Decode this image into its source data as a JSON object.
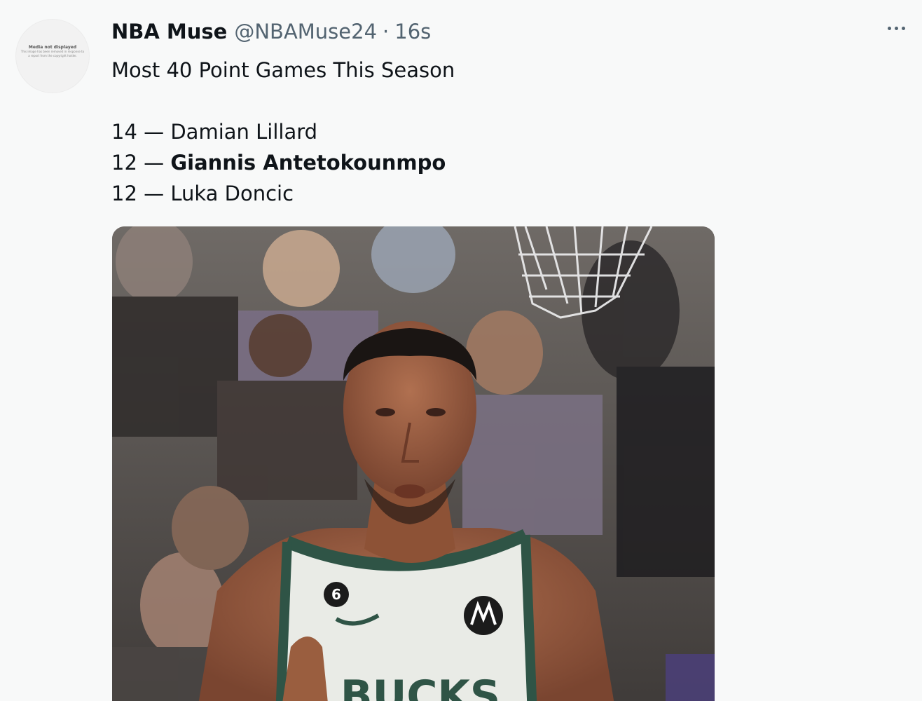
{
  "tweet": {
    "display_name": "NBA Muse",
    "handle": "@NBAMuse24",
    "separator": "·",
    "time": "16s",
    "title": "Most 40 Point Games This Season",
    "entries": [
      {
        "count": "14",
        "dash": " — ",
        "name": "Damian Lillard",
        "bold": false
      },
      {
        "count": "12",
        "dash": " — ",
        "name": "Giannis Antetokounmpo",
        "bold": true
      },
      {
        "count": "12",
        "dash": " — ",
        "name": "Luka Doncic",
        "bold": false
      }
    ]
  },
  "avatar": {
    "placeholder_title": "Media not displayed",
    "placeholder_lines": [
      "This image has been removed in response to",
      "a report from the copyright holder."
    ]
  },
  "media": {
    "jersey_number": "6",
    "jersey_text": "BUCKS",
    "colors": {
      "jersey": "#e9ebe6",
      "trim": "#2f5446",
      "skin": "#9a5e3f",
      "crowd_dark": "#3d3937"
    }
  },
  "icons": {
    "more": "more-horizontal-icon"
  }
}
